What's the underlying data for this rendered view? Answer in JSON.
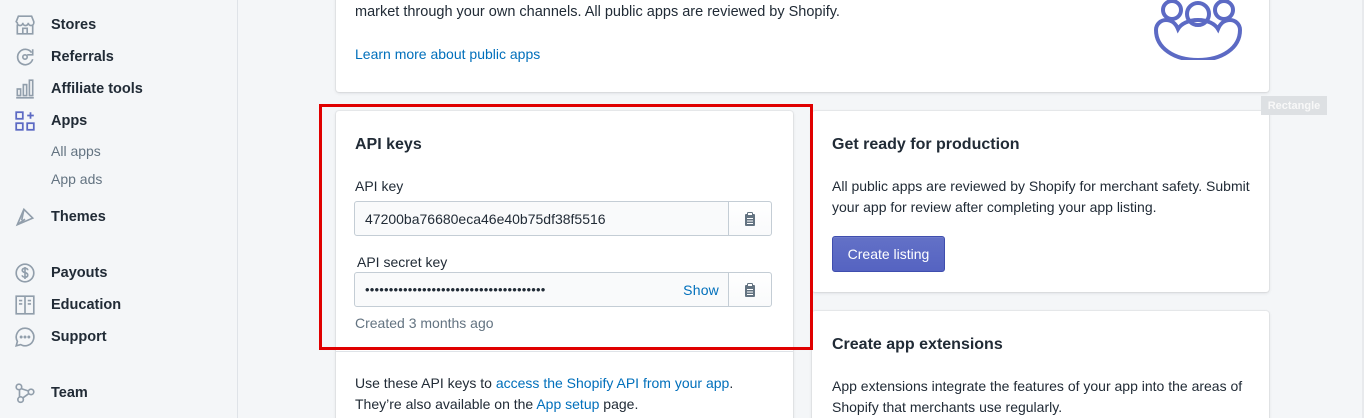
{
  "sidebar": {
    "items": [
      {
        "label": "Stores",
        "icon": "store-icon"
      },
      {
        "label": "Referrals",
        "icon": "referral-icon"
      },
      {
        "label": "Affiliate tools",
        "icon": "chart-icon"
      },
      {
        "label": "Apps",
        "icon": "apps-icon"
      },
      {
        "label": "Themes",
        "icon": "themes-icon"
      },
      {
        "label": "Payouts",
        "icon": "dollar-icon"
      },
      {
        "label": "Education",
        "icon": "book-icon"
      },
      {
        "label": "Support",
        "icon": "chat-icon"
      },
      {
        "label": "Team",
        "icon": "team-icon"
      }
    ],
    "apps_sub": [
      "All apps",
      "App ads"
    ]
  },
  "top_card": {
    "text": "market through your own channels. All public apps are reviewed by Shopify.",
    "link": "Learn more about public apps"
  },
  "api_card": {
    "title": "API keys",
    "api_key_label": "API key",
    "api_key_value": "47200ba76680eca46e40b75df38f5516",
    "secret_label": "API secret key",
    "secret_value": "••••••••••••••••••••••••••••••••••••••",
    "show_label": "Show",
    "created": "Created 3 months ago",
    "note_pre": "Use these API keys to ",
    "note_link1": "access the Shopify API from your app",
    "note_mid": ".",
    "note_line2_pre": "They’re also available on the ",
    "note_link2": "App setup",
    "note_line2_post": " page."
  },
  "production_card": {
    "title": "Get ready for production",
    "text": "All public apps are reviewed by Shopify for merchant safety. Submit your app for review after completing your app listing.",
    "button": "Create listing"
  },
  "extensions_card": {
    "title": "Create app extensions",
    "text": "App extensions integrate the features of your app into the areas of Shopify that merchants use regularly."
  },
  "overlay": {
    "tag": "Rectangle"
  },
  "colors": {
    "accent": "#5c6ac4",
    "link": "#006fbb",
    "highlight": "#e00000"
  }
}
